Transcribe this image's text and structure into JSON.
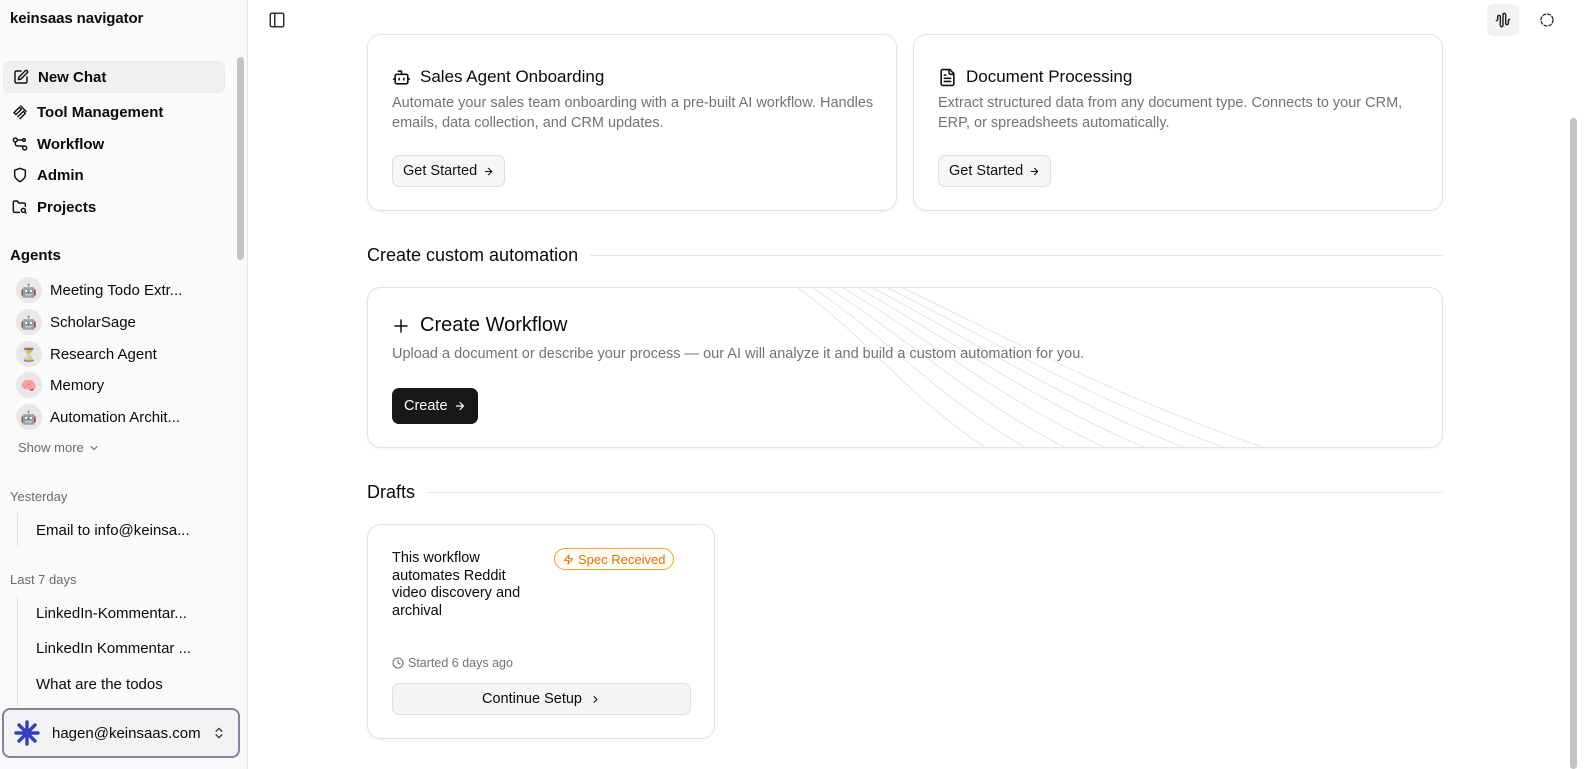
{
  "app": {
    "title": "keinsaas navigator"
  },
  "nav": {
    "new_chat": "New Chat",
    "tool_management": "Tool Management",
    "workflow": "Workflow",
    "admin": "Admin",
    "projects": "Projects"
  },
  "agents": {
    "heading": "Agents",
    "items": [
      {
        "name": "Meeting Todo Extr...",
        "icon": "robot-emoji",
        "glyph": "🤖"
      },
      {
        "name": "ScholarSage",
        "icon": "robot-emoji",
        "glyph": "🤖"
      },
      {
        "name": "Research Agent",
        "icon": "hourglass-emoji",
        "glyph": "⏳"
      },
      {
        "name": "Memory",
        "icon": "brain-emoji",
        "glyph": "🧠"
      },
      {
        "name": "Automation Archit...",
        "icon": "robot-emoji",
        "glyph": "🤖"
      }
    ],
    "show_more": "Show more"
  },
  "history": {
    "groups": [
      {
        "label": "Yesterday",
        "items": [
          "Email to info@keinsa..."
        ]
      },
      {
        "label": "Last 7 days",
        "items": [
          "LinkedIn-Kommentar...",
          "LinkedIn Kommentar ...",
          "What are the todos"
        ]
      }
    ]
  },
  "user": {
    "email": "hagen@keinsaas.com"
  },
  "templates": [
    {
      "title": "Sales Agent Onboarding",
      "icon": "bot-icon",
      "description": "Automate your sales team onboarding with a pre-built AI workflow. Handles emails, data collection, and CRM updates.",
      "button": "Get Started"
    },
    {
      "title": "Document Processing",
      "icon": "file-text-icon",
      "description": "Extract structured data from any document type. Connects to your CRM, ERP, or spreadsheets automatically.",
      "button": "Get Started"
    }
  ],
  "custom": {
    "heading": "Create custom automation",
    "title": "Create Workflow",
    "description": "Upload a document or describe your process — our AI will analyze it and build a custom automation for you.",
    "button": "Create"
  },
  "drafts": {
    "heading": "Drafts",
    "items": [
      {
        "title": "This workflow automates Reddit video discovery and archival",
        "status": "Spec Received",
        "started": "Started 6 days ago",
        "button": "Continue Setup"
      }
    ]
  },
  "colors": {
    "accent_dark": "#171717",
    "badge_orange": "#d97706",
    "muted_text": "#737373"
  }
}
